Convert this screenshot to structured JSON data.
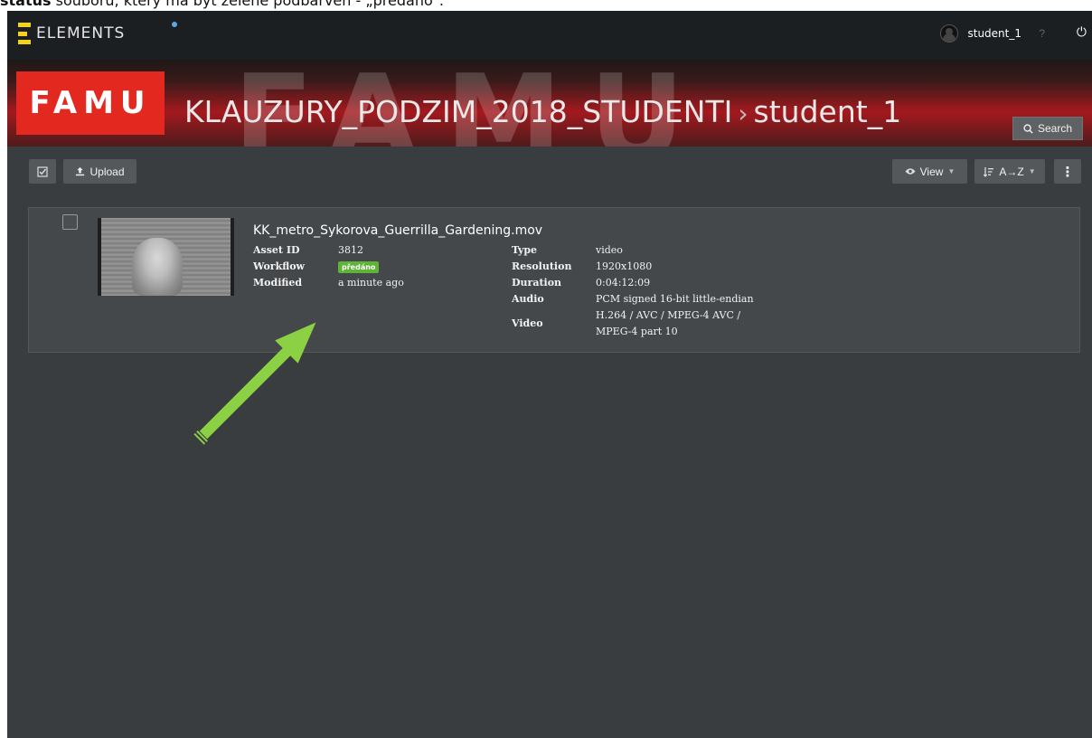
{
  "caption": {
    "prefix": "status",
    "text": " souboru, který má být zeleně podbarven - „předáno“."
  },
  "topbar": {
    "logo_text": "ELEMENTS",
    "username": "student_1",
    "help_icon": "?",
    "power_icon": "⏻"
  },
  "banner": {
    "logo": "FAMU",
    "bg_text": "FAMU",
    "path_root": "KLAUZURY_PODZIM_2018_STUDENTI",
    "separator": "›",
    "path_leaf": "student_1",
    "search_label": "Search"
  },
  "toolbar": {
    "upload_label": "Upload",
    "view_label": "View",
    "sort_label": "A→Z",
    "more_icon": "⋮"
  },
  "asset": {
    "filename": "KK_metro_Sykorova_Guerrilla_Gardening.mov",
    "left_meta": [
      {
        "label": "Asset ID",
        "value": "3812"
      },
      {
        "label": "Workflow",
        "value": "předáno"
      },
      {
        "label": "Modified",
        "value": "a minute ago"
      }
    ],
    "right_meta": [
      {
        "label": "Type",
        "value": "video"
      },
      {
        "label": "Resolution",
        "value": "1920x1080"
      },
      {
        "label": "Duration",
        "value": "0:04:12:09"
      },
      {
        "label": "Audio",
        "value": "PCM signed 16-bit little-endian"
      },
      {
        "label": "Video",
        "value": "H.264 / AVC / MPEG-4 AVC / MPEG-4 part 10"
      }
    ]
  },
  "colors": {
    "app_bg": "#3a3d40",
    "topbar_bg": "#1c1f22",
    "famu_red": "#e2281f",
    "workflow_green": "#5fb336",
    "arrow_green": "#8cd043"
  }
}
